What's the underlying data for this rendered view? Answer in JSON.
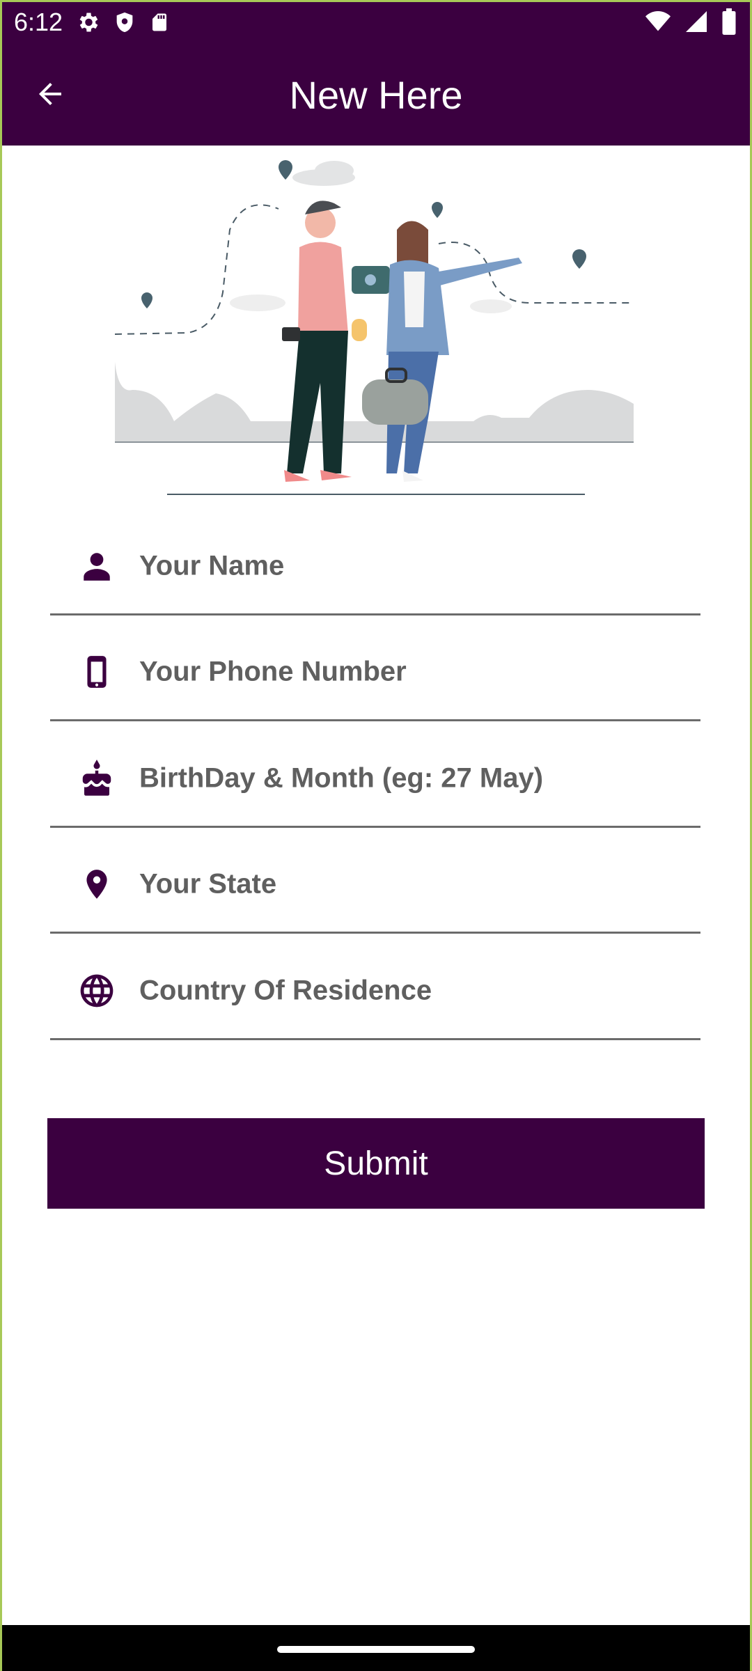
{
  "status_bar": {
    "time": "6:12",
    "icons_left": [
      "settings-icon",
      "shield-icon",
      "sd-card-icon"
    ],
    "icons_right": [
      "wifi-icon",
      "cellular-signal-icon",
      "battery-icon"
    ]
  },
  "app_bar": {
    "title": "New Here",
    "back_icon": "arrow-back-icon"
  },
  "form": {
    "fields": [
      {
        "icon": "person-icon",
        "placeholder": "Your Name",
        "value": ""
      },
      {
        "icon": "phone-icon",
        "placeholder": "Your Phone Number",
        "value": ""
      },
      {
        "icon": "cake-icon",
        "placeholder": "BirthDay & Month (eg: 27 May)",
        "value": ""
      },
      {
        "icon": "location-pin-icon",
        "placeholder": "Your State",
        "value": ""
      },
      {
        "icon": "globe-icon",
        "placeholder": "Country Of Residence",
        "value": ""
      }
    ],
    "submit_label": "Submit"
  },
  "colors": {
    "primary": "#3b0040",
    "field_underline": "#6b6b6b",
    "placeholder": "#5f5f5f",
    "background": "#ffffff"
  }
}
